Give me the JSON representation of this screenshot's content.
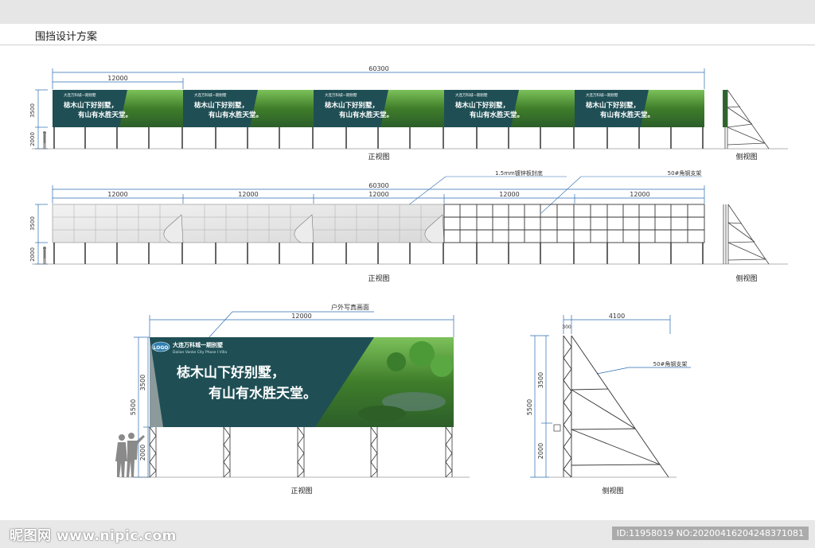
{
  "page": {
    "title": "围挡设计方案"
  },
  "row1": {
    "total_dim": "60300",
    "panel_dim": "12000",
    "height_upper": "3500",
    "height_lower": "2000",
    "front_view_label": "正视图",
    "side_view_label": "侧视图",
    "billboard_line1": "梽木山下好别墅，",
    "billboard_line2": "有山有水胜天堂。",
    "billboard_brand": "大连万科城一期别墅"
  },
  "row2": {
    "total_dim": "60300",
    "panel_dims": [
      "12000",
      "12000",
      "12000",
      "12000",
      "12000"
    ],
    "height_upper": "3500",
    "height_lower": "2000",
    "callout_sheet": "1.5mm镀锌板封底",
    "callout_frame": "50#角钢支架",
    "front_view_label": "正视图",
    "side_view_label": "侧视图"
  },
  "detail": {
    "callout_print": "户外写真画面",
    "width_dim": "12000",
    "height_total": "5500",
    "height_upper": "3500",
    "height_lower": "2000",
    "logo_text": "LOGO",
    "brand_cn": "大连万科城一期别墅",
    "brand_en": "Dalian Vanke City Phase I Villa",
    "headline1": "梽木山下好别墅，",
    "headline2": "有山有水胜天堂。",
    "front_view_label": "正视图"
  },
  "side_detail": {
    "width_dim": "4100",
    "small_dim": "300",
    "height_total": "5500",
    "height_upper": "3500",
    "height_lower": "2000",
    "callout_frame": "50#角钢支架",
    "side_view_label": "侧视图"
  },
  "watermark": {
    "site": "昵图网 www.nipic.com",
    "id_text": "ID:11958019 NO:20200416204248371081"
  },
  "colors": {
    "billboard_bg": "#1f4f55",
    "grass": "#4f8a2e",
    "steel": "#333333",
    "dim_line": "#2b6cb0"
  }
}
